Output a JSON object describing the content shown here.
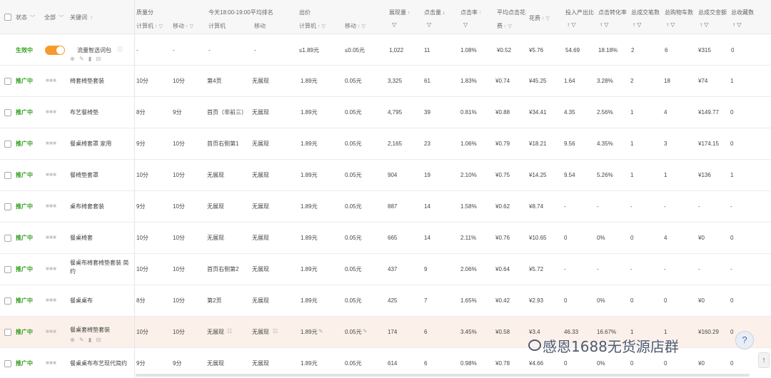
{
  "header": {
    "status": "状态",
    "all": "全部",
    "keyword": "关键词",
    "quality": "质量分",
    "rank_title": "今天18:00-19:00平均排名",
    "bid": "出价",
    "impressions": "展现量",
    "clicks": "点击量",
    "ctr": "点击率",
    "avg_cpc_line1": "平均点击花",
    "avg_cpc_line2": "费",
    "cost": "花费",
    "roi": "投入产出比",
    "cvr": "点击转化率",
    "total_deals": "总成交笔数",
    "total_cart": "总购物车数",
    "total_amount": "总成交金额",
    "total_fav": "总收藏数",
    "pc": "计算机",
    "mobile": "移动"
  },
  "smart_row": {
    "status": "生效中",
    "keyword": "流量智选词包",
    "q_pc": "-",
    "q_mobile": "-",
    "r_pc": "-",
    "r_mobile": "-",
    "bid_pc": "≤1.89元",
    "bid_mobile": "≤0.05元",
    "impressions": "1,022",
    "clicks": "11",
    "ctr": "1.08%",
    "cpc": "¥0.52",
    "cost": "¥5.76",
    "roi": "54.69",
    "cvr": "18.18%",
    "deals": "2",
    "cart": "6",
    "amount": "¥315",
    "fav": "0"
  },
  "rows": [
    {
      "status": "推广中",
      "keyword": "椅套椅垫套装",
      "q_pc": "10分",
      "q_mobile": "10分",
      "r_pc": "第4页",
      "r_mobile": "无展现",
      "bid_pc": "1.89元",
      "bid_mobile": "0.05元",
      "impressions": "3,325",
      "clicks": "61",
      "ctr": "1.83%",
      "cpc": "¥0.74",
      "cost": "¥45.25",
      "roi": "1.64",
      "cvr": "3.28%",
      "deals": "2",
      "cart": "18",
      "amount": "¥74",
      "fav": "1"
    },
    {
      "status": "推广中",
      "keyword": "布艺餐椅垫",
      "q_pc": "8分",
      "q_mobile": "9分",
      "r_pc": "首页（非前三）",
      "r_mobile": "无展现",
      "bid_pc": "1.89元",
      "bid_mobile": "0.05元",
      "impressions": "4,795",
      "clicks": "39",
      "ctr": "0.81%",
      "cpc": "¥0.88",
      "cost": "¥34.41",
      "roi": "4.35",
      "cvr": "2.56%",
      "deals": "1",
      "cart": "4",
      "amount": "¥149.77",
      "fav": "0"
    },
    {
      "status": "推广中",
      "keyword": "餐桌椅套罩 家用",
      "q_pc": "9分",
      "q_mobile": "10分",
      "r_pc": "首页右侧第1",
      "r_mobile": "无展现",
      "bid_pc": "1.89元",
      "bid_mobile": "0.05元",
      "impressions": "2,165",
      "clicks": "23",
      "ctr": "1.06%",
      "cpc": "¥0.79",
      "cost": "¥18.21",
      "roi": "9.56",
      "cvr": "4.35%",
      "deals": "1",
      "cart": "3",
      "amount": "¥174.15",
      "fav": "0"
    },
    {
      "status": "推广中",
      "keyword": "餐椅垫套罩",
      "q_pc": "10分",
      "q_mobile": "10分",
      "r_pc": "无展现",
      "r_mobile": "无展现",
      "bid_pc": "1.89元",
      "bid_mobile": "0.05元",
      "impressions": "904",
      "clicks": "19",
      "ctr": "2.10%",
      "cpc": "¥0.75",
      "cost": "¥14.25",
      "roi": "9.54",
      "cvr": "5.26%",
      "deals": "1",
      "cart": "1",
      "amount": "¥136",
      "fav": "1"
    },
    {
      "status": "推广中",
      "keyword": "桌布椅套套装",
      "q_pc": "9分",
      "q_mobile": "10分",
      "r_pc": "无展现",
      "r_mobile": "无展现",
      "bid_pc": "1.89元",
      "bid_mobile": "0.05元",
      "impressions": "887",
      "clicks": "14",
      "ctr": "1.58%",
      "cpc": "¥0.62",
      "cost": "¥8.74",
      "roi": "-",
      "cvr": "-",
      "deals": "-",
      "cart": "-",
      "amount": "-",
      "fav": "-"
    },
    {
      "status": "推广中",
      "keyword": "餐桌椅套",
      "q_pc": "10分",
      "q_mobile": "10分",
      "r_pc": "无展现",
      "r_mobile": "无展现",
      "bid_pc": "1.89元",
      "bid_mobile": "0.05元",
      "impressions": "665",
      "clicks": "14",
      "ctr": "2.11%",
      "cpc": "¥0.76",
      "cost": "¥10.65",
      "roi": "0",
      "cvr": "0%",
      "deals": "0",
      "cart": "4",
      "amount": "¥0",
      "fav": "0"
    },
    {
      "status": "推广中",
      "keyword": "餐桌布椅套椅垫套装 简",
      "keyword2": "约",
      "q_pc": "10分",
      "q_mobile": "10分",
      "r_pc": "首页右侧第2",
      "r_mobile": "无展现",
      "bid_pc": "1.89元",
      "bid_mobile": "0.05元",
      "impressions": "437",
      "clicks": "9",
      "ctr": "2.06%",
      "cpc": "¥0.64",
      "cost": "¥5.72",
      "roi": "-",
      "cvr": "-",
      "deals": "-",
      "cart": "-",
      "amount": "-",
      "fav": "-"
    },
    {
      "status": "推广中",
      "keyword": "餐桌桌布",
      "q_pc": "8分",
      "q_mobile": "10分",
      "r_pc": "第2页",
      "r_mobile": "无展现",
      "bid_pc": "1.89元",
      "bid_mobile": "0.05元",
      "impressions": "425",
      "clicks": "7",
      "ctr": "1.65%",
      "cpc": "¥0.42",
      "cost": "¥2.93",
      "roi": "0",
      "cvr": "0%",
      "deals": "0",
      "cart": "0",
      "amount": "¥0",
      "fav": "0"
    },
    {
      "status": "推广中",
      "keyword": "餐桌套椅垫套装",
      "q_pc": "10分",
      "q_mobile": "10分",
      "r_pc": "无展现",
      "r_mobile": "无展现",
      "bid_pc": "1.89元",
      "bid_mobile": "0.05元",
      "impressions": "174",
      "clicks": "6",
      "ctr": "3.45%",
      "cpc": "¥0.58",
      "cost": "¥3.4",
      "roi": "46.33",
      "cvr": "16.67%",
      "deals": "1",
      "cart": "1",
      "amount": "¥160.29",
      "fav": "0"
    },
    {
      "status": "推广中",
      "keyword": "餐桌桌布布艺现代简约",
      "q_pc": "9分",
      "q_mobile": "9分",
      "r_pc": "无展现",
      "r_mobile": "无展现",
      "bid_pc": "1.89元",
      "bid_mobile": "0.05元",
      "impressions": "614",
      "clicks": "6",
      "ctr": "0.98%",
      "cpc": "¥0.78",
      "cost": "¥4.66",
      "roi": "0",
      "cvr": "0%",
      "deals": "0",
      "cart": "0",
      "amount": "¥0",
      "fav": "0"
    }
  ],
  "watermark": "感恩1688无货源店群",
  "help_label": "?",
  "scrolltop_label": "↑",
  "icons": {
    "sort": "↑ ▽",
    "chevron": "﹀",
    "info": "ⓘ",
    "row_tools": "⊕ ✎ ▮ ⊟",
    "filter": "☷",
    "edit": "✎"
  },
  "colors": {
    "status_green": "#2f9e1c",
    "toggle_orange": "#f59b2c",
    "highlight_row": "#fbf1ea",
    "sort_active": "#2a76d9"
  }
}
